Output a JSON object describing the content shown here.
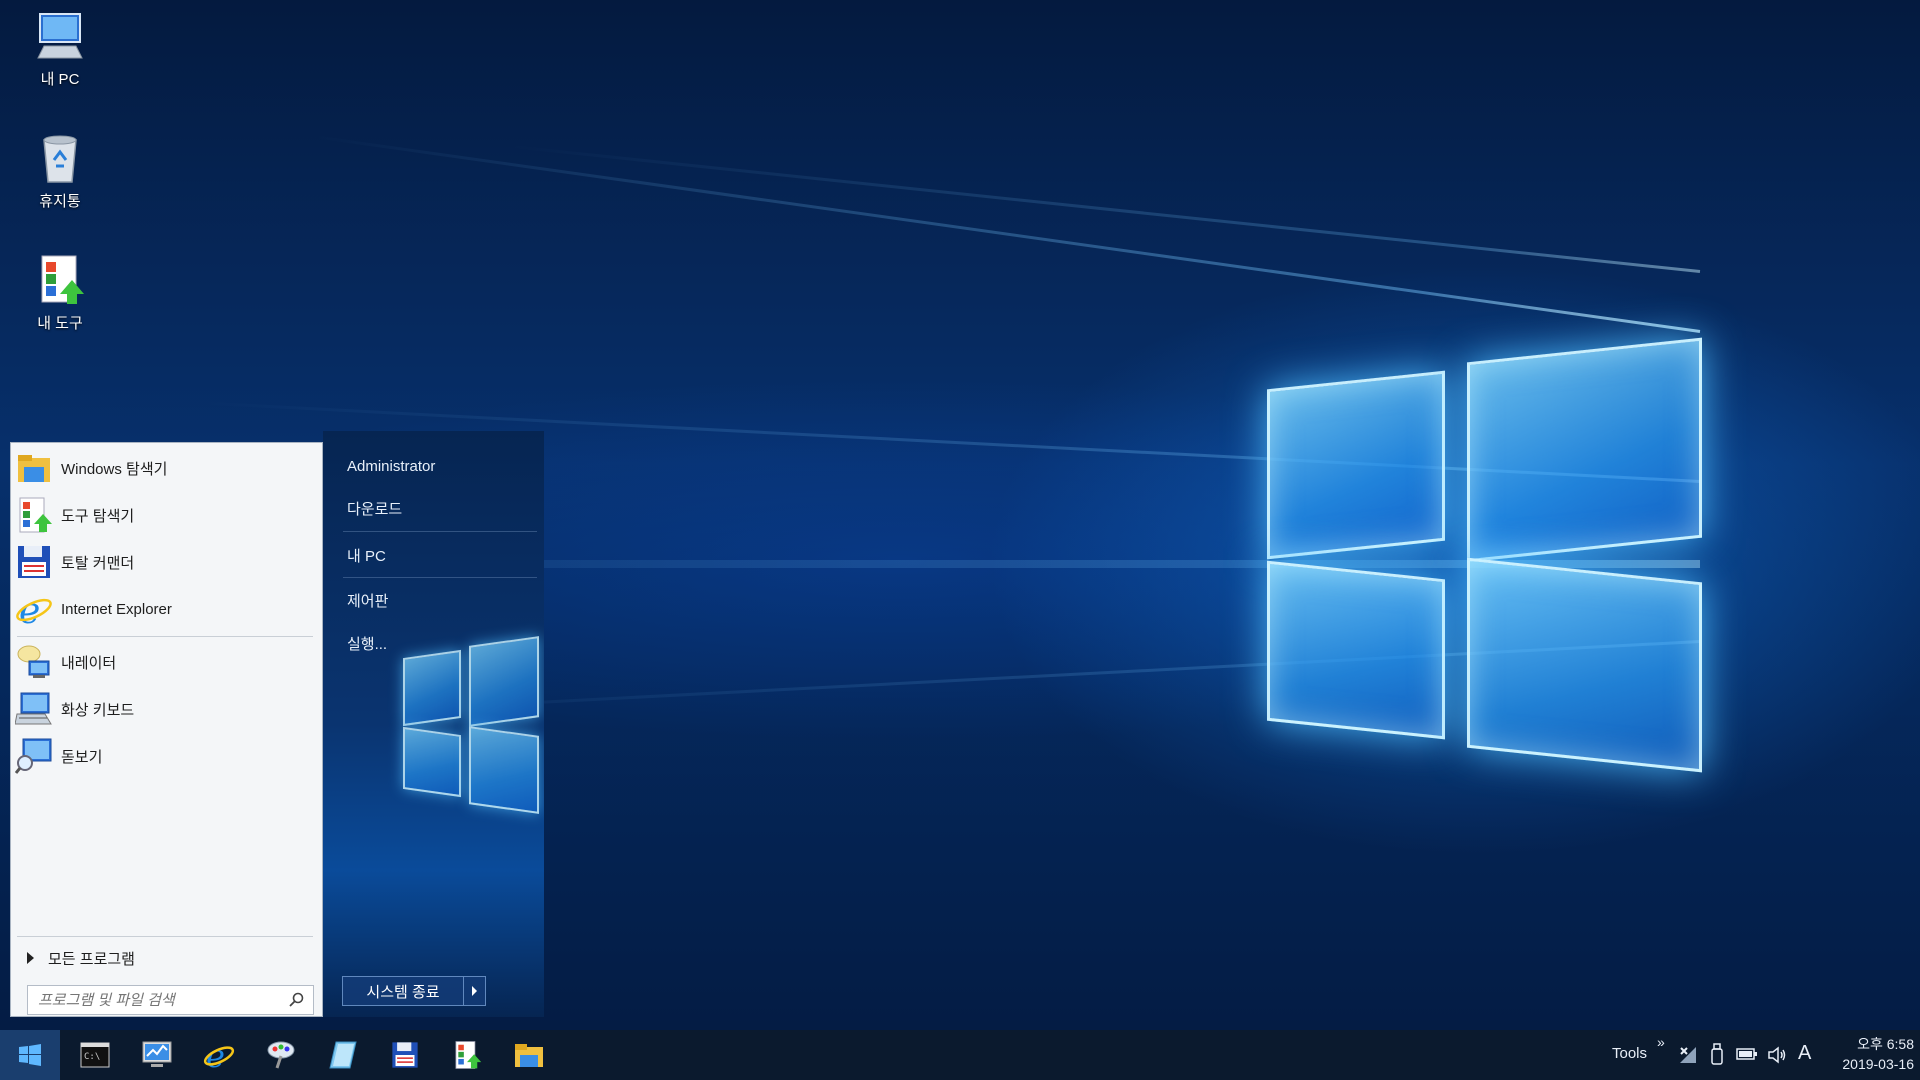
{
  "desktop_icons": [
    {
      "label": "내 PC",
      "icon": "computer-icon"
    },
    {
      "label": "휴지통",
      "icon": "recycle-bin-icon"
    },
    {
      "label": "내 도구",
      "icon": "tools-icon"
    }
  ],
  "start_menu": {
    "programs": [
      {
        "label": "Windows 탐색기",
        "icon": "folder-explorer-icon"
      },
      {
        "label": "도구 탐색기",
        "icon": "tools-explorer-icon"
      },
      {
        "label": "토탈 커맨더",
        "icon": "floppy-disk-icon"
      },
      {
        "label": "Internet Explorer",
        "icon": "internet-explorer-icon"
      },
      {
        "label": "내레이터",
        "icon": "narrator-icon"
      },
      {
        "label": "화상 키보드",
        "icon": "on-screen-keyboard-icon"
      },
      {
        "label": "돋보기",
        "icon": "magnifier-icon"
      }
    ],
    "all_programs": "모든 프로그램",
    "search_placeholder": "프로그램 및 파일 검색",
    "right_items": [
      "Administrator",
      "다운로드",
      "내 PC",
      "제어판",
      "실행..."
    ],
    "shutdown_label": "시스템 종료"
  },
  "taskbar": {
    "apps": [
      "command-prompt-icon",
      "remote-desktop-icon",
      "internet-explorer-icon",
      "paint-tool-icon",
      "notepad-icon",
      "floppy-disk-icon",
      "tools-explorer-icon",
      "folder-icon"
    ],
    "toolbar_label": "Tools",
    "toolbar_chevron": "»",
    "ime_label": "A",
    "time": "오후 6:58",
    "date": "2019-03-16"
  },
  "colors": {
    "accent": "#1a7fe0",
    "taskbar_bg": "#0b1a2e",
    "start_left_bg": "#f4f6f8"
  }
}
